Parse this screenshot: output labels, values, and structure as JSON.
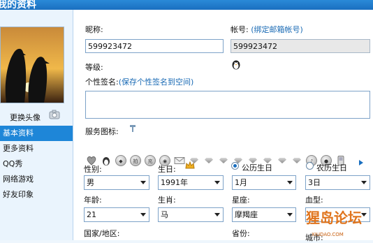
{
  "window": {
    "title": "我的资料"
  },
  "sidebar": {
    "change_avatar": "更换头像",
    "items": [
      {
        "label": "基本资料",
        "active": true
      },
      {
        "label": "更多资料",
        "active": false
      },
      {
        "label": "QQ秀",
        "active": false
      },
      {
        "label": "网络游戏",
        "active": false
      },
      {
        "label": "好友印象",
        "active": false
      }
    ]
  },
  "form": {
    "nickname": {
      "label": "昵称:",
      "value": "599923472"
    },
    "account": {
      "label": "帐号:",
      "hint": "(绑定邮箱帐号)",
      "value": "599923472"
    },
    "level": {
      "label": "等级:",
      "icon": "penguin-level-icon"
    },
    "signature": {
      "label": "个性签名:",
      "hint": "(保存个性签名到空间)",
      "value": ""
    },
    "service_icons": {
      "label": "服务图标:"
    },
    "gender": {
      "label": "性别:",
      "value": "男"
    },
    "birthday": {
      "label": "生日:",
      "year": "1991年",
      "month": "1月",
      "day": "3日"
    },
    "calendar": {
      "solar": "公历生日",
      "lunar": "农历生日",
      "selected": "solar"
    },
    "age": {
      "label": "年龄:",
      "value": "21"
    },
    "zodiac": {
      "label": "生肖:",
      "value": "马"
    },
    "constellation": {
      "label": "星座:",
      "value": "摩羯座"
    },
    "blood": {
      "label": "血型:",
      "value": ""
    },
    "country": {
      "label": "国家/地区:"
    },
    "province": {
      "label": "省份:"
    },
    "city": {
      "label": "城市:"
    }
  },
  "colors": {
    "accent": "#1e86d8",
    "hint": "#1b6bb5",
    "titlebar": "#1a6fc0"
  },
  "watermark": {
    "text": "猩岛论坛",
    "sub": "XIUDAO.COM"
  }
}
